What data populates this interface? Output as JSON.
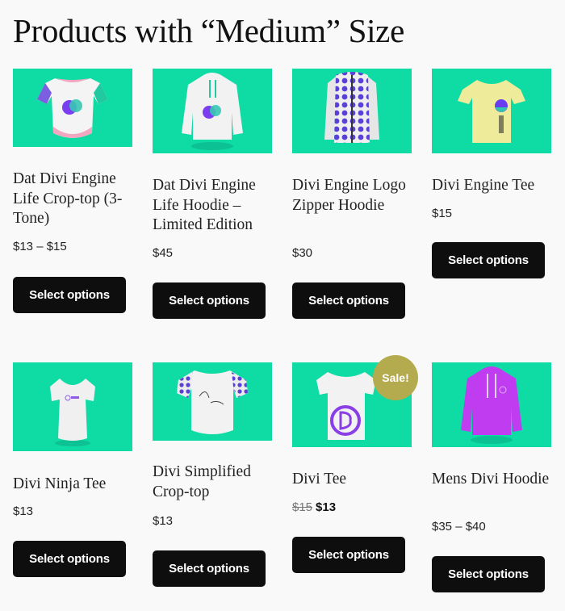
{
  "page": {
    "title": "Products with “Medium” Size"
  },
  "colors": {
    "thumb_background": "#0fdba4",
    "button_background": "#0e0e0e",
    "sale_badge": "#b4aa4e"
  },
  "products": [
    {
      "name": "Dat Divi Engine Life Crop-top (3-Tone)",
      "price": "$13 – $15",
      "button": "Select options",
      "image": "crop-top-3-tone"
    },
    {
      "name": "Dat Divi Engine Life Hoodie – Limited Edition",
      "price": "$45",
      "button": "Select options",
      "image": "white-hoodie"
    },
    {
      "name": "Divi Engine Logo Zipper Hoodie",
      "price": "$30",
      "button": "Select options",
      "image": "pattern-zipper-hoodie"
    },
    {
      "name": "Divi Engine Tee",
      "price": "$15",
      "button": "Select options",
      "image": "yellow-tee"
    },
    {
      "name": "Divi Ninja Tee",
      "price": "$13",
      "button": "Select options",
      "image": "white-vneck-tee"
    },
    {
      "name": "Divi Simplified Crop-top",
      "price": "$13",
      "button": "Select options",
      "image": "simplified-crop-top"
    },
    {
      "name": "Divi Tee",
      "price_old": "$15",
      "price_new": "$13",
      "sale_badge": "Sale!",
      "button": "Select options",
      "image": "white-divi-tee"
    },
    {
      "name": "Mens Divi Hoodie",
      "price": "$35 – $40",
      "button": "Select options",
      "image": "purple-hoodie"
    }
  ]
}
